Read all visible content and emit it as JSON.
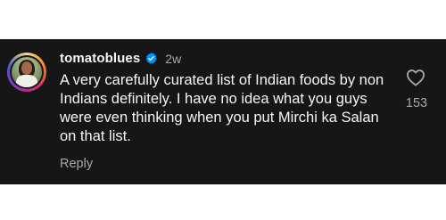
{
  "comment": {
    "username": "tomatoblues",
    "verified": true,
    "time_ago": "2w",
    "text": "A very carefully curated list of Indian foods by non Indians definitely. I have no idea what you guys were even thinking when you put Mirchi ka Salan on that list.",
    "reply_label": "Reply",
    "like_count": "153",
    "icons": {
      "verified": "verified-badge-icon",
      "like": "heart-outline-icon"
    },
    "colors": {
      "background": "#161616",
      "text": "#f5f5f5",
      "muted": "#a8a8a8",
      "verified": "#0095f6"
    }
  }
}
